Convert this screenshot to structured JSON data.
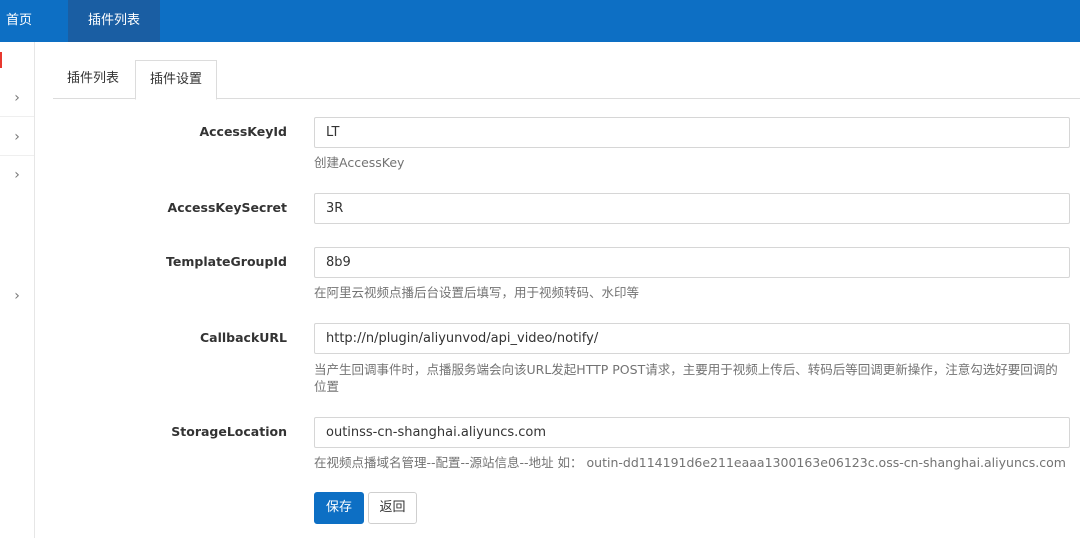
{
  "topnav": {
    "home": "首页",
    "plugins": "插件列表"
  },
  "tabs": [
    {
      "label": "插件列表"
    },
    {
      "label": "插件设置"
    }
  ],
  "form": {
    "fields": [
      {
        "label": "AccessKeyId",
        "value": "LT",
        "help": "创建AccessKey"
      },
      {
        "label": "AccessKeySecret",
        "value": "3R",
        "help": ""
      },
      {
        "label": "TemplateGroupId",
        "value": "8b9",
        "help": "在阿里云视频点播后台设置后填写，用于视频转码、水印等"
      },
      {
        "label": "CallbackURL",
        "value": "http://n/plugin/aliyunvod/api_video/notify/",
        "help": "当产生回调事件时，点播服务端会向该URL发起HTTP POST请求，主要用于视频上传后、转码后等回调更新操作，注意勾选好要回调的位置"
      },
      {
        "label": "StorageLocation",
        "value": "outinss-cn-shanghai.aliyuncs.com",
        "help": "在视频点播域名管理--配置--源站信息--地址 如： outin-dd114191d6e211eaaa1300163e06123c.oss-cn-shanghai.aliyuncs.com"
      }
    ]
  },
  "buttons": {
    "save": "保存",
    "back": "返回"
  },
  "icons": {
    "chevron": "chevron-right-icon"
  },
  "colors": {
    "primary": "#0d6fc4",
    "nav_active": "#1a5ea3",
    "sidebar_marker": "#e8382f"
  }
}
